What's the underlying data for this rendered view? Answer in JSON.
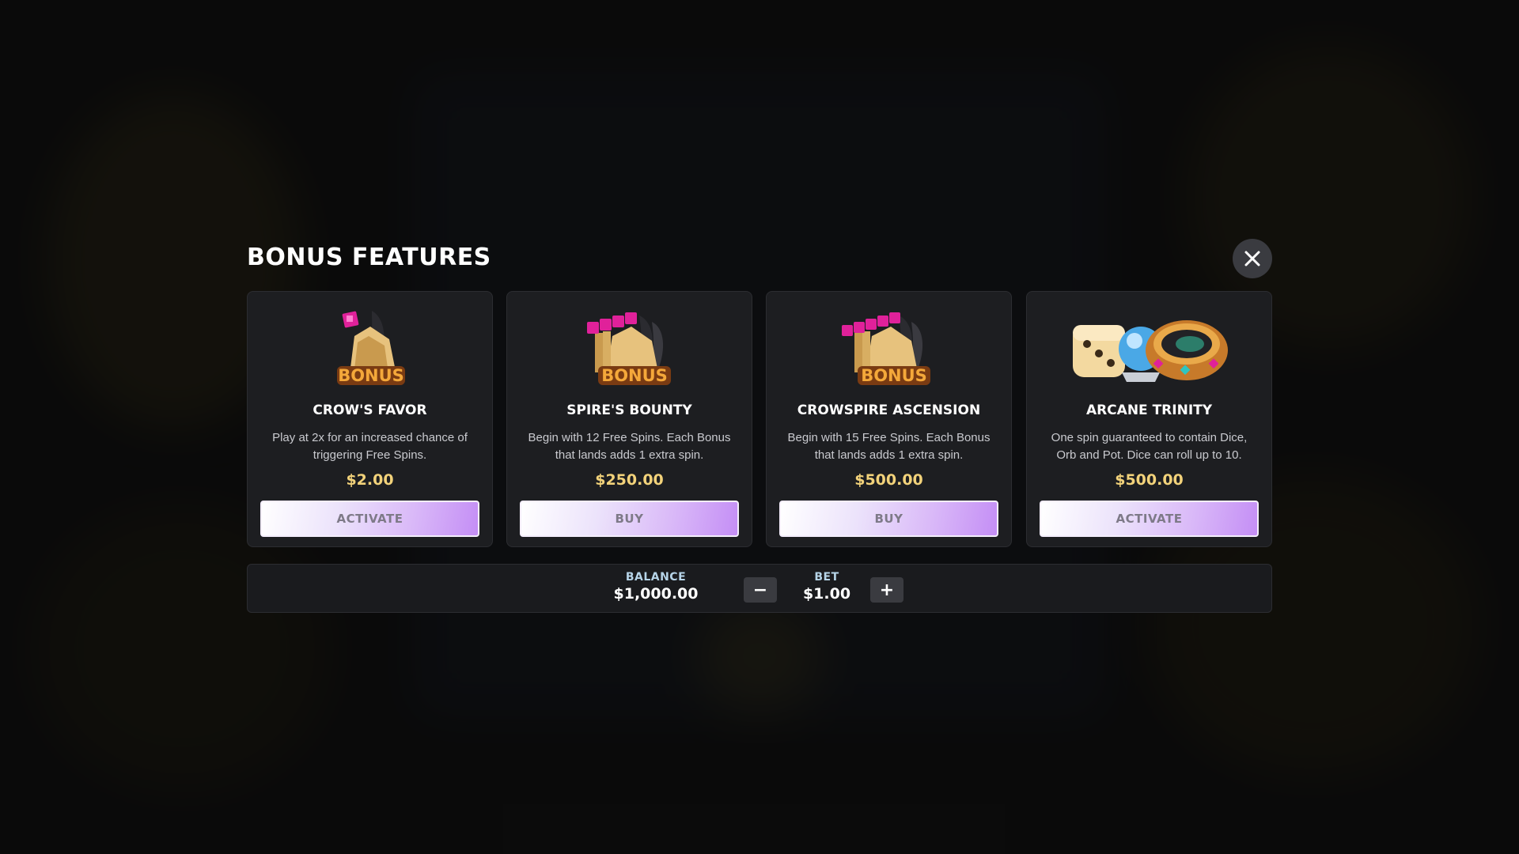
{
  "title": "BONUS FEATURES",
  "close_icon": "close-icon",
  "colors": {
    "price": "#f2d27a",
    "button_gradient_end": "#c48ef5",
    "card_bg": "#1d1e21"
  },
  "cards": [
    {
      "name": "CROW'S FAVOR",
      "description": "Play at 2x for an increased chance of triggering Free Spins.",
      "price": "$2.00",
      "button": "ACTIVATE",
      "icon": "bonus-scroll-icon"
    },
    {
      "name": "SPIRE'S BOUNTY",
      "description": "Begin with 12 Free Spins. Each Bonus that lands adds 1 extra spin.",
      "price": "$250.00",
      "button": "BUY",
      "icon": "bonus-scroll-stack-icon"
    },
    {
      "name": "CROWSPIRE ASCENSION",
      "description": "Begin with 15 Free Spins. Each Bonus that lands adds 1 extra spin.",
      "price": "$500.00",
      "button": "BUY",
      "icon": "bonus-scroll-stack-icon"
    },
    {
      "name": "ARCANE TRINITY",
      "description": "One spin guaranteed to contain Dice, Orb and Pot. Dice can roll up to 10.",
      "price": "$500.00",
      "button": "ACTIVATE",
      "icon": "dice-orb-pot-icon"
    }
  ],
  "balance": {
    "label": "BALANCE",
    "value": "$1,000.00"
  },
  "bet": {
    "label": "BET",
    "value": "$1.00",
    "decrease": "−",
    "increase": "+"
  }
}
